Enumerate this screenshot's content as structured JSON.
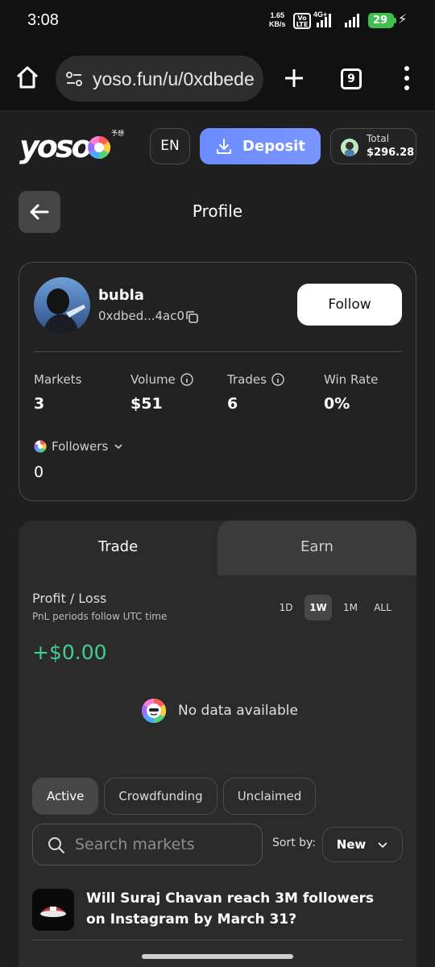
{
  "status_bar": {
    "time": "3:08",
    "speed_value": "1.65",
    "speed_unit": "KB/s",
    "volte": "Vo LTE",
    "network": "4G+",
    "battery": "29"
  },
  "browser": {
    "url": "yoso.fun/u/0xdbede",
    "tab_count": "9"
  },
  "header": {
    "logo_text": "yoso",
    "logo_sub": "予想",
    "language": "EN",
    "deposit_label": "Deposit",
    "total_label": "Total",
    "total_value": "$296.28"
  },
  "page": {
    "title": "Profile"
  },
  "profile": {
    "username": "bubla",
    "address": "0xdbed...4ac0",
    "follow_label": "Follow",
    "stats": [
      {
        "label": "Markets",
        "value": "3"
      },
      {
        "label": "Volume",
        "value": "$51"
      },
      {
        "label": "Trades",
        "value": "6"
      },
      {
        "label": "Win Rate",
        "value": "0%"
      }
    ],
    "followers_label": "Followers",
    "followers_value": "0"
  },
  "panel": {
    "tabs": [
      {
        "label": "Trade",
        "active": true
      },
      {
        "label": "Earn",
        "active": false
      }
    ],
    "pnl_title": "Profit / Loss",
    "pnl_sub": "PnL periods follow UTC time",
    "periods": [
      {
        "label": "1D",
        "active": false
      },
      {
        "label": "1W",
        "active": true
      },
      {
        "label": "1M",
        "active": false
      },
      {
        "label": "ALL",
        "active": false
      }
    ],
    "pnl_value": "+$0.00",
    "no_data": "No data available",
    "filters": [
      {
        "label": "Active",
        "active": true
      },
      {
        "label": "Crowdfunding",
        "active": false
      },
      {
        "label": "Unclaimed",
        "active": false
      }
    ],
    "search_placeholder": "Search markets",
    "sort_label": "Sort by:",
    "sort_value": "New",
    "markets": [
      {
        "title": "Will Suraj Chavan reach 3M followers on Instagram by March 31?"
      }
    ]
  },
  "colors": {
    "accent": "#7090ff",
    "profit": "#3fcf8e",
    "background": "#1f1f1f"
  }
}
